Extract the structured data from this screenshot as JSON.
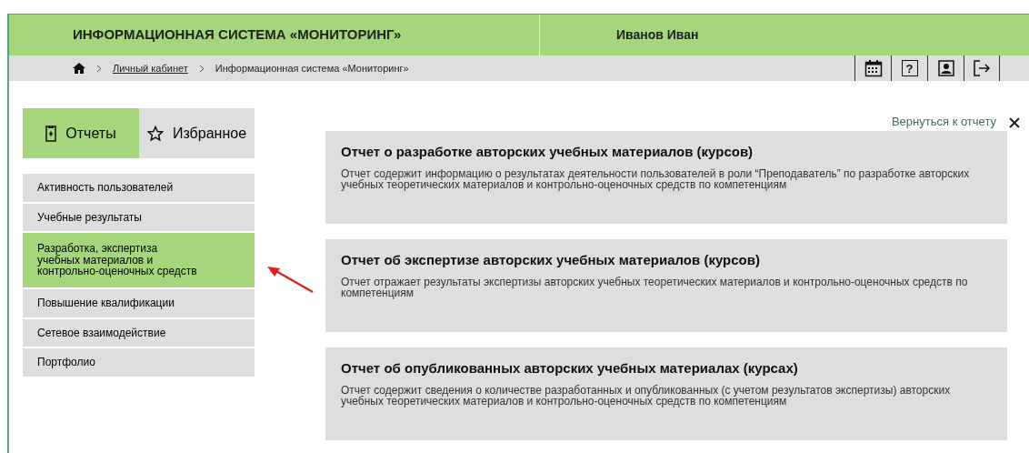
{
  "header": {
    "title": "ИНФОРМАЦИОННАЯ СИСТЕМА «МОНИТОРИНГ»",
    "user": "Иванов Иван"
  },
  "breadcrumb": [
    {
      "label": "Личный кабинет",
      "kind": "link"
    },
    {
      "label": "Информационная система «Мониторинг»",
      "kind": "current"
    }
  ],
  "toolbar": [
    {
      "kind": "calendar"
    },
    {
      "kind": "help",
      "label": "?"
    },
    {
      "kind": "profile"
    },
    {
      "kind": "logout"
    }
  ],
  "tabs": [
    {
      "label": "Отчеты",
      "kind": "reports",
      "selected": true
    },
    {
      "label": "Избранное",
      "kind": "favorites",
      "selected": false
    }
  ],
  "menu": [
    {
      "label": "Активность пользователей",
      "selected": false
    },
    {
      "label": "Учебные результаты",
      "selected": false
    },
    {
      "label": "Разработка, экспертиза учебных материалов и контрольно-оценочных средств",
      "selected": true
    },
    {
      "label": "Повышение квалификации",
      "selected": false
    },
    {
      "label": "Сетевое взаимодействие",
      "selected": false
    },
    {
      "label": "Портфолио",
      "selected": false
    }
  ],
  "back_link": "Вернуться к отчету",
  "reports": [
    {
      "title": "Отчет о разработке авторских учебных материалов (курсов)",
      "description": "Отчет содержит информацию о результатах деятельности пользователей в роли “Преподаватель” по разработке авторских учебных теоретических материалов и контрольно-оценочных средств по компетенциям"
    },
    {
      "title": "Отчет об экспертизе авторских учебных материалов (курсов)",
      "description": "Отчет отражает результаты экспертизы авторских учебных теоретических материалов и контрольно-оценочных средств по компетенциям"
    },
    {
      "title": "Отчет об опубликованных авторских учебных материалах (курсах)",
      "description": "Отчет содержит сведения о количестве разработанных и опубликованных (с учетом результатов экспертизы) авторских учебных теоретических материалов и контрольно-оценочных средств по компетенциям"
    }
  ]
}
